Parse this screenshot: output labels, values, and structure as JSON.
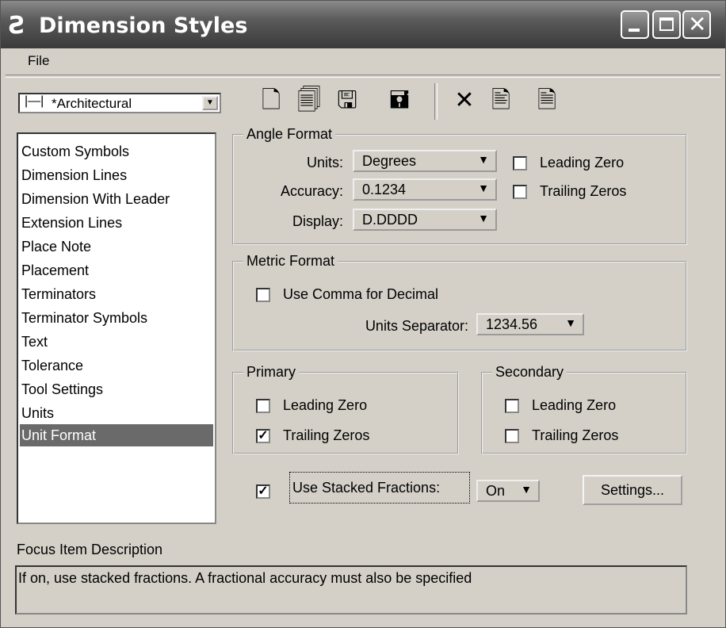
{
  "window": {
    "title": "Dimension Styles",
    "app_icon": "microstation-icon"
  },
  "menu": {
    "file": "File"
  },
  "style_combo": {
    "value": "*Architectural"
  },
  "toolbar": {
    "icons": [
      "new-style-icon",
      "properties-icon",
      "save-icon",
      "save-as-icon",
      "delete-icon",
      "update-from-element-icon",
      "match-icon"
    ]
  },
  "categories": [
    "Custom Symbols",
    "Dimension Lines",
    "Dimension With Leader",
    "Extension Lines",
    "Place Note",
    "Placement",
    "Terminators",
    "Terminator Symbols",
    "Text",
    "Tolerance",
    "Tool Settings",
    "Units",
    "Unit Format"
  ],
  "selected_category": "Unit Format",
  "angle_format": {
    "legend": "Angle Format",
    "units_label": "Units:",
    "units_value": "Degrees",
    "accuracy_label": "Accuracy:",
    "accuracy_value": "0.1234",
    "display_label": "Display:",
    "display_value": "D.DDDD",
    "leading_zero": "Leading Zero",
    "leading_zero_checked": false,
    "trailing_zeros": "Trailing Zeros",
    "trailing_zeros_checked": false
  },
  "metric_format": {
    "legend": "Metric Format",
    "use_comma": "Use Comma for Decimal",
    "use_comma_checked": false,
    "separator_label": "Units Separator:",
    "separator_value": "1234.56"
  },
  "primary": {
    "legend": "Primary",
    "leading_zero": "Leading Zero",
    "leading_zero_checked": false,
    "trailing_zeros": "Trailing Zeros",
    "trailing_zeros_checked": true
  },
  "secondary": {
    "legend": "Secondary",
    "leading_zero": "Leading Zero",
    "leading_zero_checked": false,
    "trailing_zeros": "Trailing Zeros",
    "trailing_zeros_checked": false
  },
  "stacked": {
    "label": "Use Stacked Fractions:",
    "checked": true,
    "value": "On",
    "settings_button": "Settings..."
  },
  "focus": {
    "label": "Focus Item Description",
    "text": "If on, use stacked fractions.  A fractional accuracy must also be specified"
  }
}
